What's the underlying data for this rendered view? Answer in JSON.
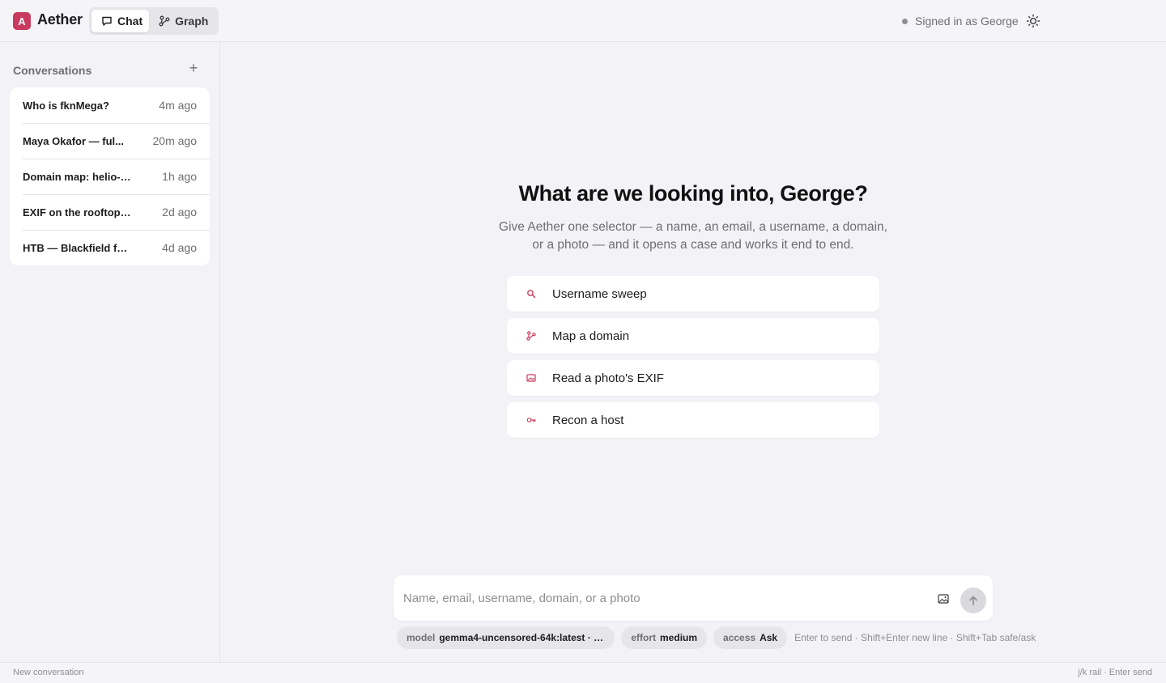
{
  "app": {
    "logo_letter": "A",
    "name": "Aether"
  },
  "tabs": {
    "chat": "Chat",
    "graph": "Graph"
  },
  "header": {
    "signed_in": "Signed in as George"
  },
  "sidebar": {
    "title": "Conversations",
    "add": "+",
    "conversations": [
      {
        "title": "Who is fknMega?",
        "time": "4m ago"
      },
      {
        "title": "Maya Okafor — ful...",
        "time": "20m ago"
      },
      {
        "title": "Domain map: helio-l...",
        "time": "1h ago"
      },
      {
        "title": "EXIF on the rooftop ...",
        "time": "2d ago"
      },
      {
        "title": "HTB — Blackfield fo...",
        "time": "4d ago"
      }
    ]
  },
  "main": {
    "title": "What are we looking into, George?",
    "subtitle": "Give Aether one selector — a name, an email, a username, a domain, or a photo — and it opens a case and works it end to end.",
    "starters": [
      {
        "label": "Username sweep",
        "icon": "search-icon"
      },
      {
        "label": "Map a domain",
        "icon": "graph-icon"
      },
      {
        "label": "Read a photo's EXIF",
        "icon": "image-icon"
      },
      {
        "label": "Recon a host",
        "icon": "key-icon"
      }
    ]
  },
  "composer": {
    "placeholder": "Name, email, username, domain, or a photo",
    "value": "",
    "model_key": "model",
    "model_value": "gemma4-uncensored-64k:latest · loa...",
    "effort_key": "effort",
    "effort_value": "medium",
    "access_key": "access",
    "access_value": "Ask",
    "hint": "Enter to send · Shift+Enter new line · Shift+Tab safe/ask"
  },
  "status": {
    "left": "New conversation",
    "right": "j/k rail · Enter send"
  },
  "colors": {
    "accent": "#c93b5e",
    "background": "#f2f2f7",
    "card": "#ffffff"
  }
}
